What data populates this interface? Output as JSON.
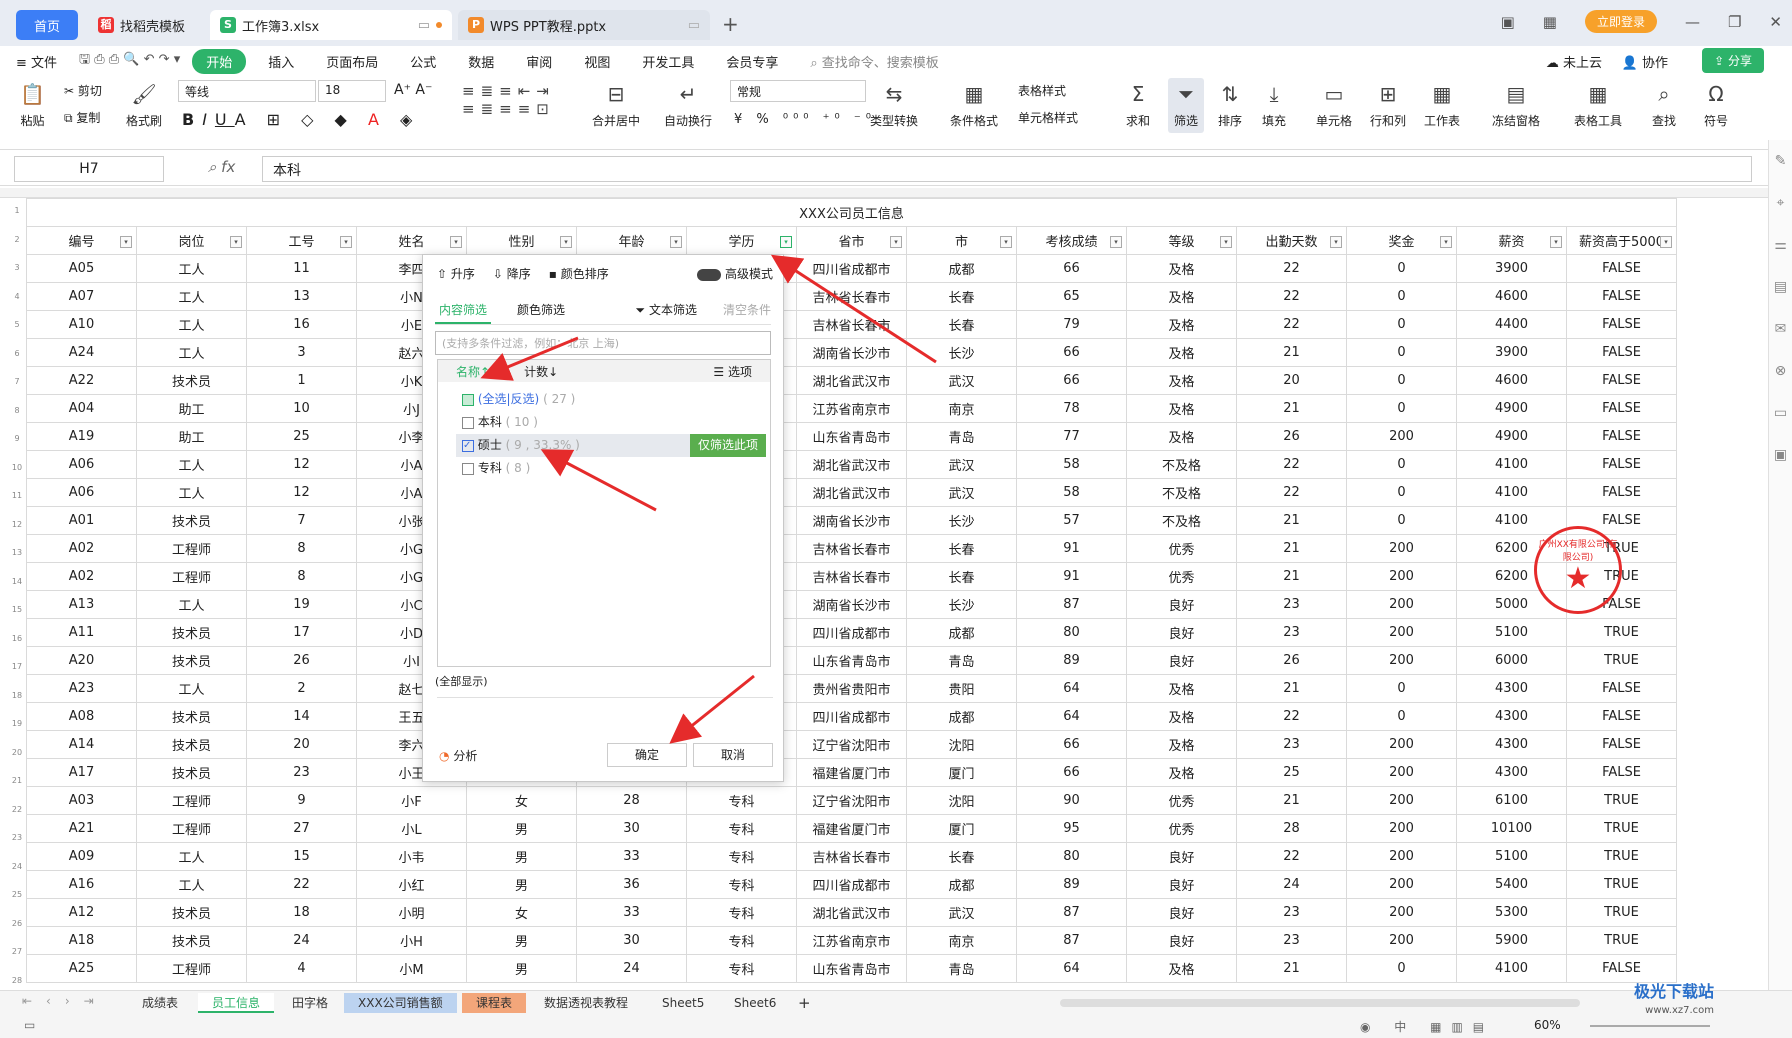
{
  "tabs": {
    "home": "首页",
    "t1": "找稻壳模板",
    "t2": "工作簿3.xlsx",
    "t3": "WPS PPT教程.pptx",
    "add": "+"
  },
  "login": "立即登录",
  "menu": {
    "file": "文件",
    "items": [
      "开始",
      "插入",
      "页面布局",
      "公式",
      "数据",
      "审阅",
      "视图",
      "开发工具",
      "会员专享"
    ],
    "search": "查找命令、搜索模板",
    "cloud": "未上云",
    "collab": "协作",
    "share": "分享"
  },
  "ribbon": {
    "paste": "粘贴",
    "cut": "剪切",
    "copy": "复制",
    "fmt": "格式刷",
    "font": "等线",
    "size": "18",
    "numfmt": "常规",
    "merge": "合并居中",
    "wrap": "自动换行",
    "convert": "类型转换",
    "cond": "条件格式",
    "tablestyle": "表格样式",
    "cellstyle": "单元格样式",
    "sum": "求和",
    "filter": "筛选",
    "sort": "排序",
    "fill": "填充",
    "cell": "单元格",
    "rowcol": "行和列",
    "worksheet": "工作表",
    "freeze": "冻结窗格",
    "tabletool": "表格工具",
    "find": "查找",
    "symbol": "符号"
  },
  "namebox": "H7",
  "formula": "本科",
  "title": "XXX公司员工信息",
  "headers": [
    "编号",
    "岗位",
    "工号",
    "姓名",
    "性别",
    "年龄",
    "学历",
    "省市",
    "市",
    "考核成绩",
    "等级",
    "出勤天数",
    "奖金",
    "薪资",
    "薪资高于5000"
  ],
  "rows": [
    [
      "A05",
      "工人",
      "11",
      "李四",
      "",
      "",
      "",
      "四川省成都市",
      "成都",
      "66",
      "及格",
      "22",
      "0",
      "3900",
      "FALSE"
    ],
    [
      "A07",
      "工人",
      "13",
      "小N",
      "",
      "",
      "",
      "吉林省长春市",
      "长春",
      "65",
      "及格",
      "22",
      "0",
      "4600",
      "FALSE"
    ],
    [
      "A10",
      "工人",
      "16",
      "小E",
      "",
      "",
      "",
      "吉林省长春市",
      "长春",
      "79",
      "及格",
      "22",
      "0",
      "4400",
      "FALSE"
    ],
    [
      "A24",
      "工人",
      "3",
      "赵六",
      "",
      "",
      "",
      "湖南省长沙市",
      "长沙",
      "66",
      "及格",
      "21",
      "0",
      "3900",
      "FALSE"
    ],
    [
      "A22",
      "技术员",
      "1",
      "小K",
      "",
      "",
      "",
      "湖北省武汉市",
      "武汉",
      "66",
      "及格",
      "20",
      "0",
      "4600",
      "FALSE"
    ],
    [
      "A04",
      "助工",
      "10",
      "小J",
      "",
      "",
      "",
      "江苏省南京市",
      "南京",
      "78",
      "及格",
      "21",
      "0",
      "4900",
      "FALSE"
    ],
    [
      "A19",
      "助工",
      "25",
      "小李",
      "",
      "",
      "",
      "山东省青岛市",
      "青岛",
      "77",
      "及格",
      "26",
      "200",
      "4900",
      "FALSE"
    ],
    [
      "A06",
      "工人",
      "12",
      "小A",
      "",
      "",
      "",
      "湖北省武汉市",
      "武汉",
      "58",
      "不及格",
      "22",
      "0",
      "4100",
      "FALSE"
    ],
    [
      "A06",
      "工人",
      "12",
      "小A",
      "",
      "",
      "",
      "湖北省武汉市",
      "武汉",
      "58",
      "不及格",
      "22",
      "0",
      "4100",
      "FALSE"
    ],
    [
      "A01",
      "技术员",
      "7",
      "小张",
      "",
      "",
      "",
      "湖南省长沙市",
      "长沙",
      "57",
      "不及格",
      "21",
      "0",
      "4100",
      "FALSE"
    ],
    [
      "A02",
      "工程师",
      "8",
      "小G",
      "",
      "",
      "",
      "吉林省长春市",
      "长春",
      "91",
      "优秀",
      "21",
      "200",
      "6200",
      "TRUE"
    ],
    [
      "A02",
      "工程师",
      "8",
      "小G",
      "",
      "",
      "",
      "吉林省长春市",
      "长春",
      "91",
      "优秀",
      "21",
      "200",
      "6200",
      "TRUE"
    ],
    [
      "A13",
      "工人",
      "19",
      "小C",
      "",
      "",
      "",
      "湖南省长沙市",
      "长沙",
      "87",
      "良好",
      "23",
      "200",
      "5000",
      "FALSE"
    ],
    [
      "A11",
      "技术员",
      "17",
      "小D",
      "",
      "",
      "",
      "四川省成都市",
      "成都",
      "80",
      "良好",
      "23",
      "200",
      "5100",
      "TRUE"
    ],
    [
      "A20",
      "技术员",
      "26",
      "小I",
      "",
      "",
      "",
      "山东省青岛市",
      "青岛",
      "89",
      "良好",
      "26",
      "200",
      "6000",
      "TRUE"
    ],
    [
      "A23",
      "工人",
      "2",
      "赵七",
      "",
      "",
      "",
      "贵州省贵阳市",
      "贵阳",
      "64",
      "及格",
      "21",
      "0",
      "4300",
      "FALSE"
    ],
    [
      "A08",
      "技术员",
      "14",
      "王五",
      "",
      "",
      "",
      "四川省成都市",
      "成都",
      "64",
      "及格",
      "22",
      "0",
      "4300",
      "FALSE"
    ],
    [
      "A14",
      "技术员",
      "20",
      "李六",
      "",
      "",
      "",
      "辽宁省沈阳市",
      "沈阳",
      "66",
      "及格",
      "23",
      "200",
      "4300",
      "FALSE"
    ],
    [
      "A17",
      "技术员",
      "23",
      "小王",
      "",
      "",
      "",
      "福建省厦门市",
      "厦门",
      "66",
      "及格",
      "25",
      "200",
      "4300",
      "FALSE"
    ],
    [
      "A03",
      "工程师",
      "9",
      "小F",
      "女",
      "28",
      "专科",
      "辽宁省沈阳市",
      "沈阳",
      "90",
      "优秀",
      "21",
      "200",
      "6100",
      "TRUE"
    ],
    [
      "A21",
      "工程师",
      "27",
      "小L",
      "男",
      "30",
      "专科",
      "福建省厦门市",
      "厦门",
      "95",
      "优秀",
      "28",
      "200",
      "10100",
      "TRUE"
    ],
    [
      "A09",
      "工人",
      "15",
      "小韦",
      "男",
      "33",
      "专科",
      "吉林省长春市",
      "长春",
      "80",
      "良好",
      "22",
      "200",
      "5100",
      "TRUE"
    ],
    [
      "A16",
      "工人",
      "22",
      "小红",
      "男",
      "36",
      "专科",
      "四川省成都市",
      "成都",
      "89",
      "良好",
      "24",
      "200",
      "5400",
      "TRUE"
    ],
    [
      "A12",
      "技术员",
      "18",
      "小明",
      "女",
      "33",
      "专科",
      "湖北省武汉市",
      "武汉",
      "87",
      "良好",
      "23",
      "200",
      "5300",
      "TRUE"
    ],
    [
      "A18",
      "技术员",
      "24",
      "小H",
      "男",
      "30",
      "专科",
      "江苏省南京市",
      "南京",
      "87",
      "良好",
      "23",
      "200",
      "5900",
      "TRUE"
    ],
    [
      "A25",
      "工程师",
      "4",
      "小M",
      "男",
      "24",
      "专科",
      "山东省青岛市",
      "青岛",
      "64",
      "及格",
      "21",
      "0",
      "4100",
      "FALSE"
    ]
  ],
  "popup": {
    "asc": "升序",
    "desc": "降序",
    "colorsort": "颜色排序",
    "advanced": "高级模式",
    "tab_content": "内容筛选",
    "tab_color": "颜色筛选",
    "textfilter": "文本筛选",
    "clear": "清空条件",
    "search_ph": "(支持多条件过滤，例如：北京 上海)",
    "name_col": "名称↑",
    "count_col": "计数↓",
    "options": "选项",
    "items": [
      {
        "label": "(全选|反选)",
        "count": "( 27 )"
      },
      {
        "label": "本科",
        "count": "( 10 )"
      },
      {
        "label": "硕士",
        "count": "( 9 , 33.3% )"
      },
      {
        "label": "专科",
        "count": "( 8 )"
      }
    ],
    "only": "仅筛选此项",
    "showall": "(全部显示)",
    "analyze": "分析",
    "ok": "确定",
    "cancel": "取消"
  },
  "seal_text": "广州XX有限公司(有限公司)",
  "sheets": [
    "成绩表",
    "员工信息",
    "田字格",
    "XXX公司销售额",
    "课程表",
    "数据透视表教程",
    "Sheet5",
    "Sheet6"
  ],
  "zoom": "60%",
  "watermark": "极光下载站",
  "watermark_url": "www.xz7.com"
}
